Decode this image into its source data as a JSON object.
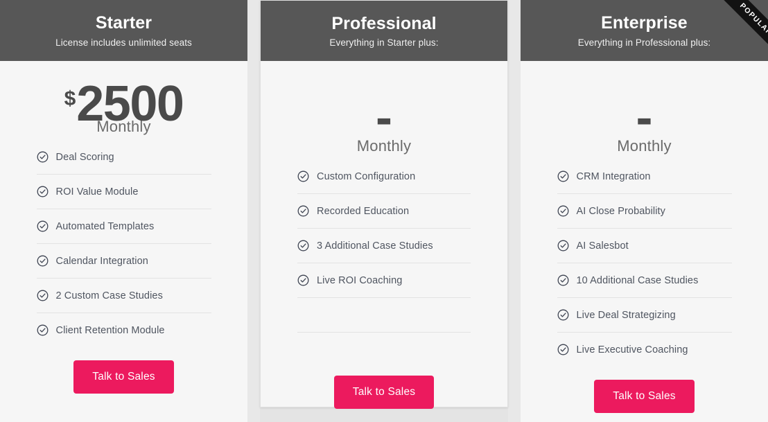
{
  "theme": {
    "header_bg": "#575757",
    "card_bg": "#f6f6f6",
    "page_bg": "#e4e4e4",
    "accent": "#ec1a5e",
    "ribbon_bg": "#121212",
    "text": "#4f5560"
  },
  "ribbon": {
    "label": "POPULAR"
  },
  "plans": [
    {
      "id": "starter",
      "name": "Starter",
      "subtitle": "License includes unlimited seats",
      "currency": "$",
      "amount": "2500",
      "period": "Monthly",
      "features": [
        "Deal Scoring",
        "ROI Value Module",
        "Automated Templates",
        "Calendar Integration",
        "2 Custom Case Studies",
        "Client Retention Module"
      ],
      "cta_label": "Talk to Sales"
    },
    {
      "id": "professional",
      "name": "Professional",
      "subtitle": "Everything in Starter plus:",
      "currency": "",
      "amount": "-",
      "period": "Monthly",
      "features": [
        "Custom Configuration",
        "Recorded Education",
        "3 Additional Case Studies",
        "Live ROI Coaching",
        "",
        ""
      ],
      "cta_label": "Talk to Sales"
    },
    {
      "id": "enterprise",
      "name": "Enterprise",
      "subtitle": "Everything in Professional plus:",
      "currency": "",
      "amount": "-",
      "period": "Monthly",
      "features": [
        "CRM Integration",
        "AI Close Probability",
        "AI Salesbot",
        "10 Additional Case Studies",
        "Live Deal Strategizing",
        "Live Executive Coaching"
      ],
      "cta_label": "Talk to Sales"
    }
  ],
  "icons": {
    "check_circle": "check-circle-icon"
  }
}
